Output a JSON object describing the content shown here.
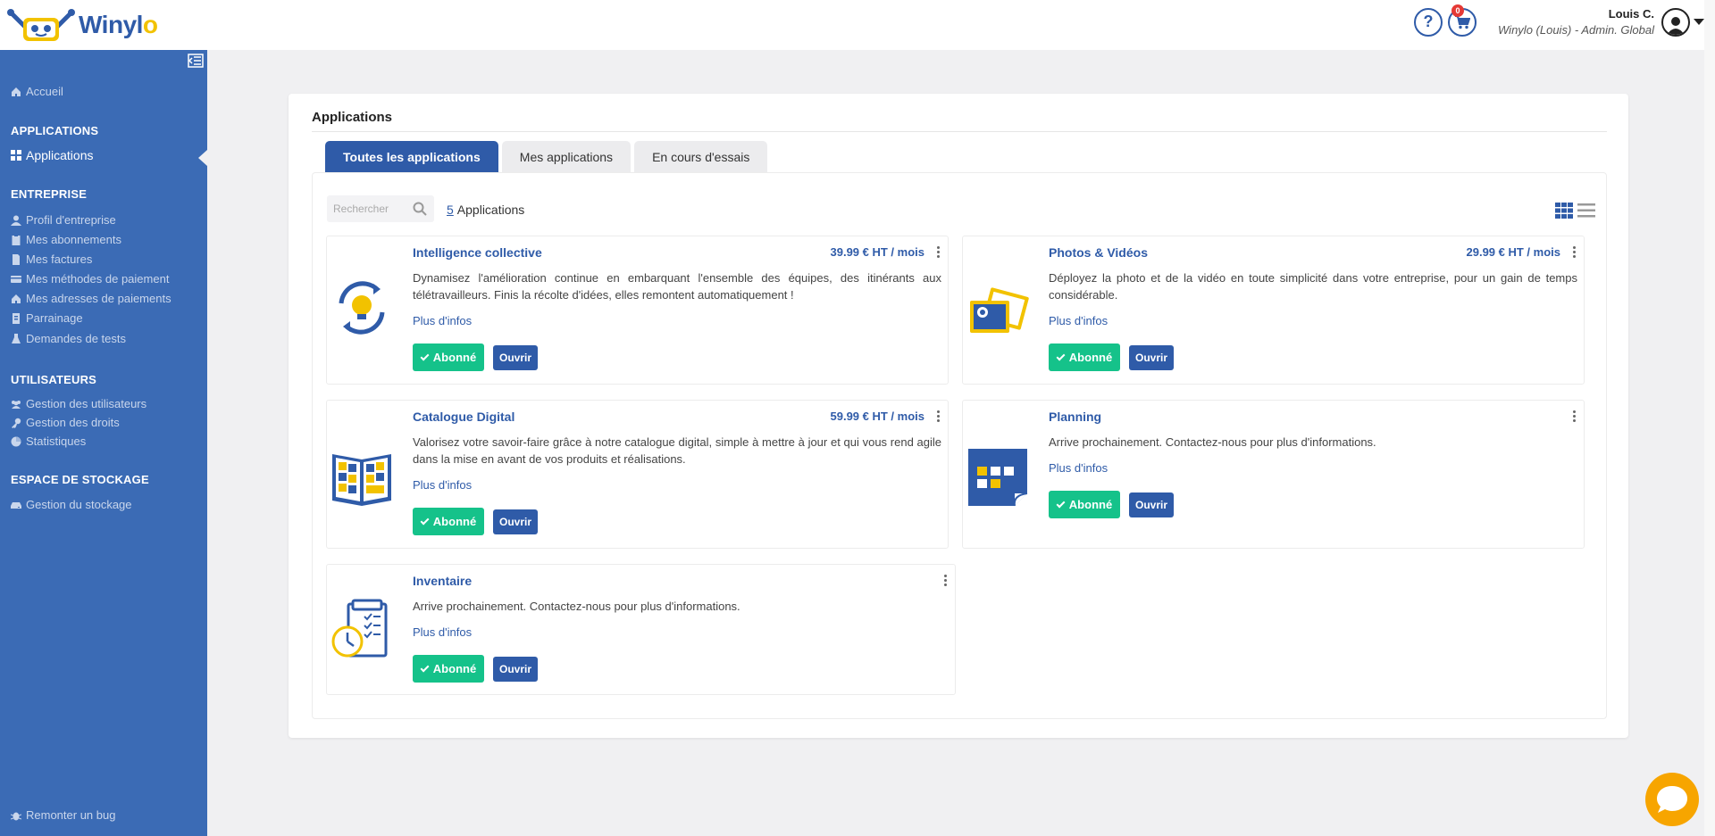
{
  "header": {
    "logo_text": "Winyl",
    "logo_suffix": "o",
    "help_symbol": "?",
    "cart_count": "0",
    "user_name": "Louis C.",
    "user_role": "Winylo (Louis) - Admin. Global"
  },
  "sidebar": {
    "home": "Accueil",
    "sections": [
      {
        "title": "APPLICATIONS",
        "items": [
          {
            "label": "Applications",
            "icon": "grid-icon"
          }
        ]
      },
      {
        "title": "ENTREPRISE",
        "items": [
          {
            "label": "Profil d'entreprise",
            "icon": "user-icon"
          },
          {
            "label": "Mes abonnements",
            "icon": "clipboard-icon"
          },
          {
            "label": "Mes factures",
            "icon": "file-icon"
          },
          {
            "label": "Mes méthodes de paiement",
            "icon": "credit-card-icon"
          },
          {
            "label": "Mes adresses de paiements",
            "icon": "home-icon"
          },
          {
            "label": "Parrainage",
            "icon": "file-invoice-icon"
          },
          {
            "label": "Demandes de tests",
            "icon": "flask-icon"
          }
        ]
      },
      {
        "title": "UTILISATEURS",
        "items": [
          {
            "label": "Gestion des utilisateurs",
            "icon": "users-icon"
          },
          {
            "label": "Gestion des droits",
            "icon": "key-icon"
          },
          {
            "label": "Statistiques",
            "icon": "pie-chart-icon"
          }
        ]
      },
      {
        "title": "ESPACE DE STOCKAGE",
        "items": [
          {
            "label": "Gestion du stockage",
            "icon": "hdd-icon"
          }
        ]
      }
    ],
    "report_bug": "Remonter un bug"
  },
  "main": {
    "title": "Applications",
    "tabs": [
      {
        "label": "Toutes les applications",
        "active": true
      },
      {
        "label": "Mes applications",
        "active": false
      },
      {
        "label": "En cours d'essais",
        "active": false
      }
    ],
    "search_placeholder": "Rechercher",
    "count_number": "5",
    "count_label": "Applications",
    "apps": [
      {
        "name": "Intelligence collective",
        "price": "39.99 € HT / mois",
        "description": "Dynamisez l'amélioration continue en embarquant l'ensemble des équipes, des itinérants aux télétravailleurs. Finis la récolte d'idées, elles remontent automatiquement !",
        "more": "Plus d'infos",
        "subscribed": "Abonné",
        "open": "Ouvrir",
        "icon": "lightbulb-cycle-icon"
      },
      {
        "name": "Photos & Vidéos",
        "price": "29.99 € HT / mois",
        "description": "Déployez la photo et de la vidéo en toute simplicité dans votre entreprise, pour un gain de temps considérable.",
        "more": "Plus d'infos",
        "subscribed": "Abonné",
        "open": "Ouvrir",
        "icon": "photos-icon"
      },
      {
        "name": "Catalogue Digital",
        "price": "59.99 € HT / mois",
        "description": "Valorisez votre savoir-faire grâce à notre catalogue digital, simple à mettre à jour et qui vous rend agile dans la mise en avant de vos produits et réalisations.",
        "more": "Plus d'infos",
        "subscribed": "Abonné",
        "open": "Ouvrir",
        "icon": "catalog-book-icon"
      },
      {
        "name": "Planning",
        "price": "",
        "description": "Arrive prochainement. Contactez-nous pour plus d'informations.",
        "more": "Plus d'infos",
        "subscribed": "Abonné",
        "open": "Ouvrir",
        "icon": "calendar-icon"
      },
      {
        "name": "Inventaire",
        "price": "",
        "description": "Arrive prochainement. Contactez-nous pour plus d'informations.",
        "more": "Plus d'infos",
        "subscribed": "Abonné",
        "open": "Ouvrir",
        "icon": "clipboard-clock-icon"
      }
    ]
  },
  "colors": {
    "primary": "#2f5ba8",
    "sidebar": "#3b6bb5",
    "success": "#15c28a",
    "accent_yellow": "#f2c200",
    "chat": "#f7a500"
  }
}
